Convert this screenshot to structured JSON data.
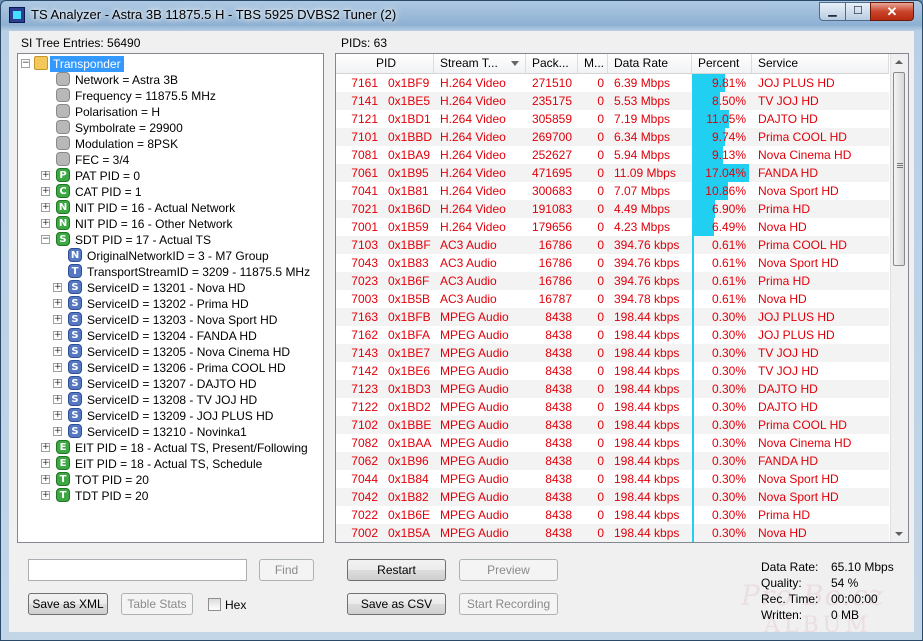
{
  "window": {
    "title": "TS Analyzer - Astra 3B 11875.5 H - TBS 5925 DVBS2 Tuner (2)",
    "controls": {
      "minimize": "▁",
      "maximize": "☐",
      "close": "✕"
    }
  },
  "left": {
    "caption": "SI Tree Entries: 56490",
    "tree": [
      {
        "level": 0,
        "expander": "−",
        "icon": "folder",
        "label": "Transponder",
        "selected": true
      },
      {
        "level": 1,
        "expander": "",
        "icon": "gray",
        "label": "Network = Astra 3B"
      },
      {
        "level": 1,
        "expander": "",
        "icon": "gray",
        "label": "Frequency = 11875.5 MHz"
      },
      {
        "level": 1,
        "expander": "",
        "icon": "gray",
        "label": "Polarisation = H"
      },
      {
        "level": 1,
        "expander": "",
        "icon": "gray",
        "label": "Symbolrate = 29900"
      },
      {
        "level": 1,
        "expander": "",
        "icon": "gray",
        "label": "Modulation = 8PSK"
      },
      {
        "level": 1,
        "expander": "",
        "icon": "gray",
        "label": "FEC = 3/4"
      },
      {
        "level": 1,
        "expander": "+",
        "icon": "green",
        "letter": "P",
        "label": "PAT PID = 0"
      },
      {
        "level": 1,
        "expander": "+",
        "icon": "green",
        "letter": "C",
        "label": "CAT PID = 1"
      },
      {
        "level": 1,
        "expander": "+",
        "icon": "green",
        "letter": "N",
        "label": "NIT PID = 16 - Actual Network"
      },
      {
        "level": 1,
        "expander": "+",
        "icon": "green",
        "letter": "N",
        "label": "NIT PID = 16 - Other Network"
      },
      {
        "level": 1,
        "expander": "−",
        "icon": "green",
        "letter": "S",
        "label": "SDT PID = 17 - Actual TS"
      },
      {
        "level": 2,
        "expander": "",
        "icon": "blue",
        "letter": "N",
        "label": "OriginalNetworkID = 3 - M7 Group"
      },
      {
        "level": 2,
        "expander": "",
        "icon": "blue",
        "letter": "T",
        "label": "TransportStreamID = 3209 - 11875.5 MHz"
      },
      {
        "level": 2,
        "expander": "+",
        "icon": "blue",
        "letter": "S",
        "label": "ServiceID = 13201 - Nova HD"
      },
      {
        "level": 2,
        "expander": "+",
        "icon": "blue",
        "letter": "S",
        "label": "ServiceID = 13202 - Prima HD"
      },
      {
        "level": 2,
        "expander": "+",
        "icon": "blue",
        "letter": "S",
        "label": "ServiceID = 13203 - Nova Sport HD"
      },
      {
        "level": 2,
        "expander": "+",
        "icon": "blue",
        "letter": "S",
        "label": "ServiceID = 13204 - FANDA HD"
      },
      {
        "level": 2,
        "expander": "+",
        "icon": "blue",
        "letter": "S",
        "label": "ServiceID = 13205 - Nova Cinema HD"
      },
      {
        "level": 2,
        "expander": "+",
        "icon": "blue",
        "letter": "S",
        "label": "ServiceID = 13206 - Prima COOL HD"
      },
      {
        "level": 2,
        "expander": "+",
        "icon": "blue",
        "letter": "S",
        "label": "ServiceID = 13207 - DAJTO HD"
      },
      {
        "level": 2,
        "expander": "+",
        "icon": "blue",
        "letter": "S",
        "label": "ServiceID = 13208 - TV JOJ HD"
      },
      {
        "level": 2,
        "expander": "+",
        "icon": "blue",
        "letter": "S",
        "label": "ServiceID = 13209 - JOJ PLUS HD"
      },
      {
        "level": 2,
        "expander": "+",
        "icon": "blue",
        "letter": "S",
        "label": "ServiceID = 13210 - Novinka1"
      },
      {
        "level": 1,
        "expander": "+",
        "icon": "green",
        "letter": "E",
        "label": "EIT PID = 18 - Actual TS, Present/Following"
      },
      {
        "level": 1,
        "expander": "+",
        "icon": "green",
        "letter": "E",
        "label": "EIT PID = 18 - Actual TS, Schedule"
      },
      {
        "level": 1,
        "expander": "+",
        "icon": "green",
        "letter": "T",
        "label": "TOT PID = 20"
      },
      {
        "level": 1,
        "expander": "+",
        "icon": "green",
        "letter": "T",
        "label": "TDT PID = 20"
      }
    ],
    "search_value": "",
    "find_label": "Find",
    "save_xml_label": "Save as XML",
    "table_stats_label": "Table Stats",
    "hex_label": "Hex"
  },
  "right": {
    "caption": "PIDs: 63",
    "columns": [
      "PID",
      "Stream T...",
      "Pack...",
      "M...",
      "Data Rate",
      "Percent",
      "Service"
    ],
    "rows": [
      {
        "pid_dec": "7161",
        "pid_hex": "0x1BF9",
        "type": "H.264 Video",
        "packets": "271510",
        "m": "0",
        "rate": "6.39 Mbps",
        "pct_text": "9.81%",
        "pct": 9.81,
        "service": "JOJ PLUS HD"
      },
      {
        "pid_dec": "7141",
        "pid_hex": "0x1BE5",
        "type": "H.264 Video",
        "packets": "235175",
        "m": "0",
        "rate": "5.53 Mbps",
        "pct_text": "8.50%",
        "pct": 8.5,
        "service": "TV JOJ HD"
      },
      {
        "pid_dec": "7121",
        "pid_hex": "0x1BD1",
        "type": "H.264 Video",
        "packets": "305859",
        "m": "0",
        "rate": "7.19 Mbps",
        "pct_text": "11.05%",
        "pct": 11.05,
        "service": "DAJTO HD"
      },
      {
        "pid_dec": "7101",
        "pid_hex": "0x1BBD",
        "type": "H.264 Video",
        "packets": "269700",
        "m": "0",
        "rate": "6.34 Mbps",
        "pct_text": "9.74%",
        "pct": 9.74,
        "service": "Prima COOL HD"
      },
      {
        "pid_dec": "7081",
        "pid_hex": "0x1BA9",
        "type": "H.264 Video",
        "packets": "252627",
        "m": "0",
        "rate": "5.94 Mbps",
        "pct_text": "9.13%",
        "pct": 9.13,
        "service": "Nova Cinema HD"
      },
      {
        "pid_dec": "7061",
        "pid_hex": "0x1B95",
        "type": "H.264 Video",
        "packets": "471695",
        "m": "0",
        "rate": "11.09 Mbps",
        "pct_text": "17.04%",
        "pct": 17.04,
        "service": "FANDA HD"
      },
      {
        "pid_dec": "7041",
        "pid_hex": "0x1B81",
        "type": "H.264 Video",
        "packets": "300683",
        "m": "0",
        "rate": "7.07 Mbps",
        "pct_text": "10.86%",
        "pct": 10.86,
        "service": "Nova Sport HD"
      },
      {
        "pid_dec": "7021",
        "pid_hex": "0x1B6D",
        "type": "H.264 Video",
        "packets": "191083",
        "m": "0",
        "rate": "4.49 Mbps",
        "pct_text": "6.90%",
        "pct": 6.9,
        "service": "Prima HD"
      },
      {
        "pid_dec": "7001",
        "pid_hex": "0x1B59",
        "type": "H.264 Video",
        "packets": "179656",
        "m": "0",
        "rate": "4.23 Mbps",
        "pct_text": "6.49%",
        "pct": 6.49,
        "service": "Nova HD"
      },
      {
        "pid_dec": "7103",
        "pid_hex": "0x1BBF",
        "type": "AC3 Audio",
        "packets": "16786",
        "m": "0",
        "rate": "394.76 kbps",
        "pct_text": "0.61%",
        "pct": 0.61,
        "service": "Prima COOL HD"
      },
      {
        "pid_dec": "7043",
        "pid_hex": "0x1B83",
        "type": "AC3 Audio",
        "packets": "16786",
        "m": "0",
        "rate": "394.76 kbps",
        "pct_text": "0.61%",
        "pct": 0.61,
        "service": "Nova Sport HD"
      },
      {
        "pid_dec": "7023",
        "pid_hex": "0x1B6F",
        "type": "AC3 Audio",
        "packets": "16786",
        "m": "0",
        "rate": "394.76 kbps",
        "pct_text": "0.61%",
        "pct": 0.61,
        "service": "Prima HD"
      },
      {
        "pid_dec": "7003",
        "pid_hex": "0x1B5B",
        "type": "AC3 Audio",
        "packets": "16787",
        "m": "0",
        "rate": "394.78 kbps",
        "pct_text": "0.61%",
        "pct": 0.61,
        "service": "Nova HD"
      },
      {
        "pid_dec": "7163",
        "pid_hex": "0x1BFB",
        "type": "MPEG Audio",
        "packets": "8438",
        "m": "0",
        "rate": "198.44 kbps",
        "pct_text": "0.30%",
        "pct": 0.3,
        "service": "JOJ PLUS HD"
      },
      {
        "pid_dec": "7162",
        "pid_hex": "0x1BFA",
        "type": "MPEG Audio",
        "packets": "8438",
        "m": "0",
        "rate": "198.44 kbps",
        "pct_text": "0.30%",
        "pct": 0.3,
        "service": "JOJ PLUS HD"
      },
      {
        "pid_dec": "7143",
        "pid_hex": "0x1BE7",
        "type": "MPEG Audio",
        "packets": "8438",
        "m": "0",
        "rate": "198.44 kbps",
        "pct_text": "0.30%",
        "pct": 0.3,
        "service": "TV JOJ HD"
      },
      {
        "pid_dec": "7142",
        "pid_hex": "0x1BE6",
        "type": "MPEG Audio",
        "packets": "8438",
        "m": "0",
        "rate": "198.44 kbps",
        "pct_text": "0.30%",
        "pct": 0.3,
        "service": "TV JOJ HD"
      },
      {
        "pid_dec": "7123",
        "pid_hex": "0x1BD3",
        "type": "MPEG Audio",
        "packets": "8438",
        "m": "0",
        "rate": "198.44 kbps",
        "pct_text": "0.30%",
        "pct": 0.3,
        "service": "DAJTO HD"
      },
      {
        "pid_dec": "7122",
        "pid_hex": "0x1BD2",
        "type": "MPEG Audio",
        "packets": "8438",
        "m": "0",
        "rate": "198.44 kbps",
        "pct_text": "0.30%",
        "pct": 0.3,
        "service": "DAJTO HD"
      },
      {
        "pid_dec": "7102",
        "pid_hex": "0x1BBE",
        "type": "MPEG Audio",
        "packets": "8438",
        "m": "0",
        "rate": "198.44 kbps",
        "pct_text": "0.30%",
        "pct": 0.3,
        "service": "Prima COOL HD"
      },
      {
        "pid_dec": "7082",
        "pid_hex": "0x1BAA",
        "type": "MPEG Audio",
        "packets": "8438",
        "m": "0",
        "rate": "198.44 kbps",
        "pct_text": "0.30%",
        "pct": 0.3,
        "service": "Nova Cinema HD"
      },
      {
        "pid_dec": "7062",
        "pid_hex": "0x1B96",
        "type": "MPEG Audio",
        "packets": "8438",
        "m": "0",
        "rate": "198.44 kbps",
        "pct_text": "0.30%",
        "pct": 0.3,
        "service": "FANDA HD"
      },
      {
        "pid_dec": "7044",
        "pid_hex": "0x1B84",
        "type": "MPEG Audio",
        "packets": "8438",
        "m": "0",
        "rate": "198.44 kbps",
        "pct_text": "0.30%",
        "pct": 0.3,
        "service": "Nova Sport HD"
      },
      {
        "pid_dec": "7042",
        "pid_hex": "0x1B82",
        "type": "MPEG Audio",
        "packets": "8438",
        "m": "0",
        "rate": "198.44 kbps",
        "pct_text": "0.30%",
        "pct": 0.3,
        "service": "Nova Sport HD"
      },
      {
        "pid_dec": "7022",
        "pid_hex": "0x1B6E",
        "type": "MPEG Audio",
        "packets": "8438",
        "m": "0",
        "rate": "198.44 kbps",
        "pct_text": "0.30%",
        "pct": 0.3,
        "service": "Prima HD"
      },
      {
        "pid_dec": "7002",
        "pid_hex": "0x1B5A",
        "type": "MPEG Audio",
        "packets": "8438",
        "m": "0",
        "rate": "198.44 kbps",
        "pct_text": "0.30%",
        "pct": 0.3,
        "service": "Nova HD"
      }
    ],
    "restart_label": "Restart",
    "preview_label": "Preview",
    "save_csv_label": "Save as CSV",
    "start_recording_label": "Start Recording",
    "stats": [
      {
        "label": "Data Rate:",
        "value": "65.10 Mbps"
      },
      {
        "label": "Quality:",
        "value": "54 %"
      },
      {
        "label": "Rec. Time:",
        "value": "00:00:00"
      },
      {
        "label": "Written:",
        "value": "0 MB"
      }
    ]
  },
  "watermark": {
    "line1": "Pro Bo.cz",
    "line2": "ALBUM"
  },
  "colors": {
    "row_text": "#e0000a",
    "percent_bar": "#21d0f0",
    "selection": "#3399ff"
  }
}
